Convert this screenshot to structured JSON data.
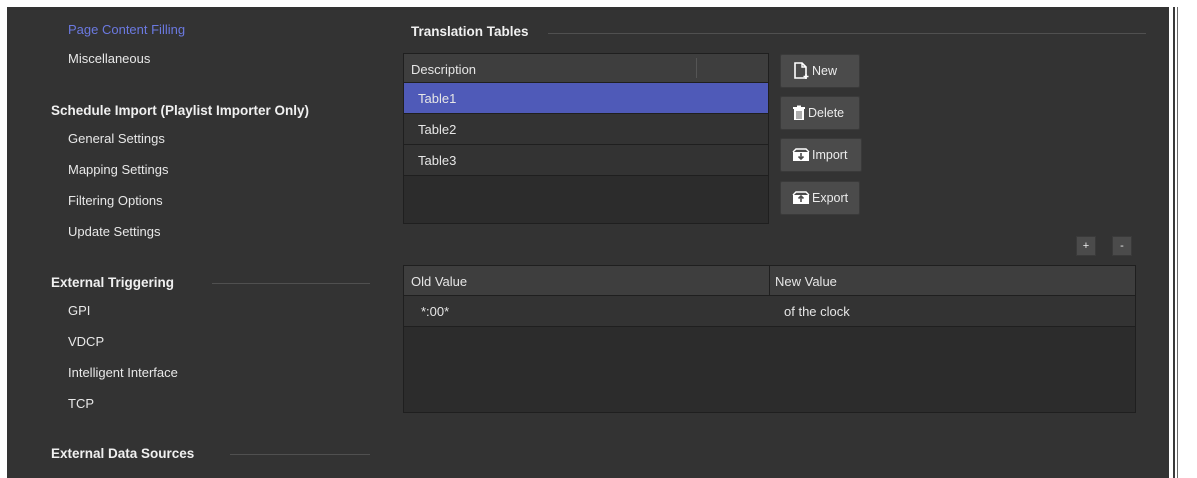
{
  "sidebar": {
    "items": [
      {
        "label": "Page Content Filling",
        "active": true
      },
      {
        "label": "Miscellaneous"
      }
    ],
    "sections": [
      {
        "title": "Schedule Import (Playlist Importer Only)",
        "items": [
          "General Settings",
          "Mapping Settings",
          "Filtering Options",
          "Update Settings"
        ]
      },
      {
        "title": "External Triggering",
        "items": [
          "GPI",
          "VDCP",
          "Intelligent Interface",
          "TCP"
        ]
      },
      {
        "title": "External Data Sources",
        "items": []
      }
    ]
  },
  "translation_tables": {
    "title": "Translation Tables",
    "column_header": "Description",
    "rows": [
      "Table1",
      "Table2",
      "Table3"
    ],
    "selected": "Table1",
    "buttons": {
      "new": "New",
      "delete": "Delete",
      "import": "Import",
      "export": "Export"
    }
  },
  "values_table": {
    "add_label": "+",
    "remove_label": "-",
    "headers": {
      "old": "Old Value",
      "new": "New Value"
    },
    "rows": [
      {
        "old": "*:00*",
        "new": "of the clock"
      }
    ]
  },
  "colors": {
    "background": "#333333",
    "accent": "#6b79e0",
    "selection": "#4f5ab8"
  }
}
